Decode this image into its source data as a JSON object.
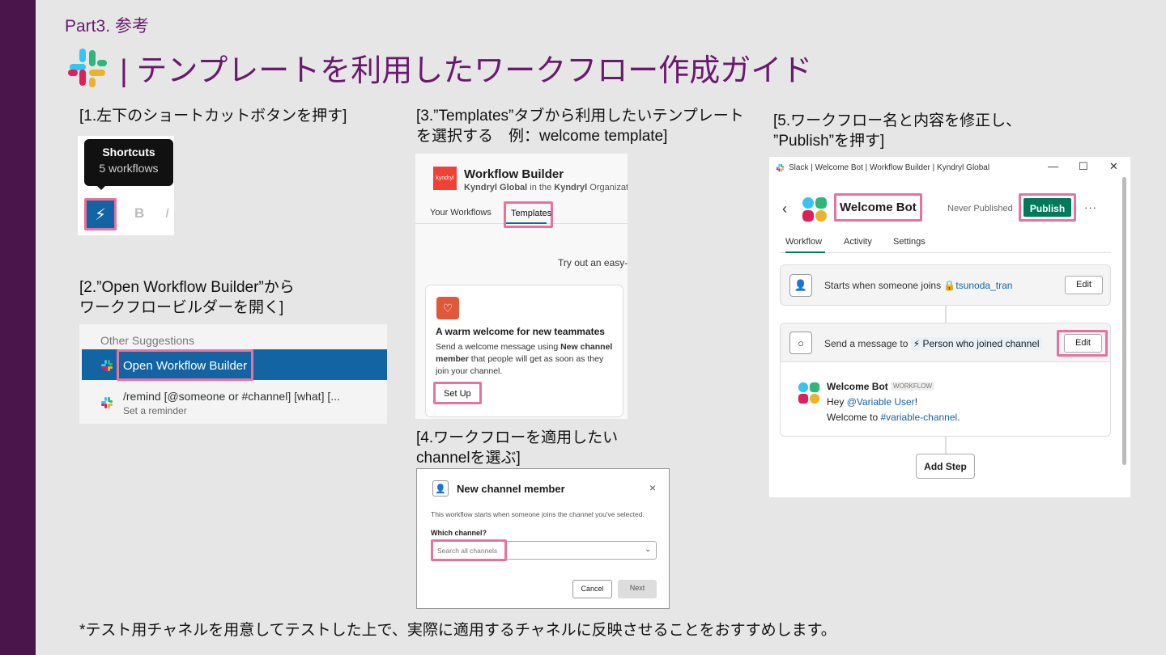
{
  "header": {
    "part": "Part3. 参考",
    "title": "| テンプレートを利用したワークフロー作成ガイド"
  },
  "steps": {
    "s1": "[1.左下のショートカットボタンを押す]",
    "s2_l1": "[2.”Open Workflow Builder”から",
    "s2_l2": "ワークフロービルダーを開く]",
    "s3_l1": "[3.”Templates”タブから利用したいテンプレート",
    "s3_l2": "を選択する　例：welcome template]",
    "s4_l1": "[4.ワークフローを適用したい",
    "s4_l2": "channelを選ぶ]",
    "s5_l1": "[5.ワークフロー名と内容を修正し、",
    "s5_l2": "”Publish”を押す]"
  },
  "shortcuts": {
    "tooltip_title": "Shortcuts",
    "tooltip_sub": "5 workflows",
    "bold": "B",
    "italic": "I"
  },
  "suggestions": {
    "header": "Other Suggestions",
    "open_wb": "Open Workflow Builder",
    "remind": "/remind [@someone or #channel] [what] [...",
    "remind_sub": "Set a reminder"
  },
  "templates": {
    "logo_text": "kyndryl",
    "title": "Workflow Builder",
    "sub_org": "Kyndryl Global",
    "sub_mid": " in the ",
    "sub_org2": "Kyndryl",
    "sub_end": " Organization",
    "tab_your": "Your Workflows",
    "tab_templates": "Templates",
    "tryout": "Try out an easy-t",
    "card_title": "A warm welcome for new teammates",
    "card_desc_1": "Send a welcome message using ",
    "card_desc_bold": "New channel member",
    "card_desc_2": " that people will get as soon as they join your channel.",
    "setup": "Set Up"
  },
  "channel_dialog": {
    "title": "New channel member",
    "close": "×",
    "desc": "This workflow starts when someone joins the channel you've selected.",
    "which": "Which channel?",
    "placeholder": "Search all channels",
    "cancel": "Cancel",
    "next": "Next"
  },
  "workflow": {
    "window_title": "Slack | Welcome Bot | Workflow Builder | Kyndryl Global",
    "minimize": "—",
    "maximize": "☐",
    "close": "✕",
    "name": "Welcome Bot",
    "never_published": "Never Published",
    "publish": "Publish",
    "more": "···",
    "tab_workflow": "Workflow",
    "tab_activity": "Activity",
    "tab_settings": "Settings",
    "trigger_text": "Starts when someone joins ",
    "trigger_channel": "tsunoda_tran",
    "edit": "Edit",
    "send_text": "Send a message to ",
    "send_target": "Person who joined channel",
    "bot_name": "Welcome Bot",
    "bot_tag": "WORKFLOW",
    "msg_hey": "Hey ",
    "msg_user": "@Variable User",
    "msg_excl": "!",
    "msg_welcome": "Welcome to ",
    "msg_channel": "#variable-channel",
    "msg_dot": ".",
    "add_step": "Add Step"
  },
  "footnote": "*テスト用チャネルを用意してテストした上で、実際に適用するチャネルに反映させることをおすすめします。",
  "colors": {
    "sidebar": "#4a154b",
    "title": "#6a1a6e",
    "highlight": "#e5739f",
    "publish": "#007a5a",
    "slack_blue": "#1264a3"
  }
}
